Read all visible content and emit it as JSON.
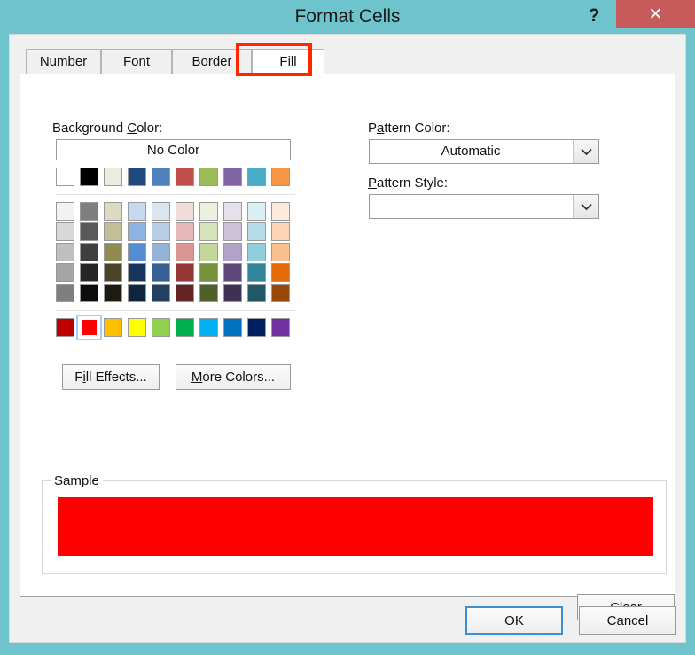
{
  "window": {
    "title": "Format Cells",
    "help_icon": "question-mark-icon",
    "close_icon": "✕",
    "frame_color": "#6ec4cd",
    "close_button_color": "#c75b5b"
  },
  "tabs": [
    {
      "label": "Number",
      "selected": false
    },
    {
      "label": "Font",
      "selected": false
    },
    {
      "label": "Border",
      "selected": false
    },
    {
      "label": "Fill",
      "selected": true
    }
  ],
  "annotation": {
    "target": "Fill",
    "color": "#ff2600",
    "shape": "rectangle"
  },
  "fill_tab": {
    "background_color": {
      "label_prefix": "Background ",
      "label_accel": "C",
      "label_suffix": "olor:",
      "no_color_label": "No Color",
      "theme_colors": [
        "#ffffff",
        "#000000",
        "#eeece1",
        "#1f497d",
        "#4f81bd",
        "#c0504d",
        "#9bbb59",
        "#8064a2",
        "#4bacc6",
        "#f79646"
      ],
      "variant_rows": [
        [
          "#f2f2f2",
          "#7f7f7f",
          "#ddd9c3",
          "#c6d9f0",
          "#dbe5f1",
          "#f2dcdb",
          "#ebf1dd",
          "#e5e0ec",
          "#dbeef3",
          "#fdeada"
        ],
        [
          "#d8d8d8",
          "#595959",
          "#c4bd97",
          "#8db3e2",
          "#b8cce4",
          "#e5b9b7",
          "#d7e3bc",
          "#ccc1d9",
          "#b7dde8",
          "#fbd5b5"
        ],
        [
          "#bfbfbf",
          "#3f3f3f",
          "#938953",
          "#548dd4",
          "#95b3d7",
          "#d99694",
          "#c3d69b",
          "#b2a2c7",
          "#92cddc",
          "#fac08f"
        ],
        [
          "#a5a5a5",
          "#262626",
          "#494429",
          "#17365d",
          "#366092",
          "#953734",
          "#76923c",
          "#5f497a",
          "#31859b",
          "#e36c09"
        ],
        [
          "#7f7f7f",
          "#0c0c0c",
          "#1d1b10",
          "#0f243e",
          "#244061",
          "#632423",
          "#4f6128",
          "#3f3151",
          "#205867",
          "#974806"
        ]
      ],
      "standard_colors": [
        "#c00000",
        "#ff0000",
        "#ffc000",
        "#ffff00",
        "#92d050",
        "#00b050",
        "#00b0f0",
        "#0070c0",
        "#002060",
        "#7030a0"
      ],
      "selected_standard_index": 1,
      "selected_color": "#ff0000"
    },
    "fill_effects_button": {
      "prefix": "F",
      "accel": "i",
      "suffix": "ll Effects..."
    },
    "more_colors_button": {
      "prefix": "",
      "accel": "M",
      "suffix": "ore Colors..."
    },
    "pattern_color": {
      "label_prefix": "P",
      "label_accel": "a",
      "label_suffix": "ttern Color:",
      "value": "Automatic",
      "dropdown_icon": "chevron-down-icon"
    },
    "pattern_style": {
      "label_prefix": "",
      "label_accel": "P",
      "label_suffix": "attern Style:",
      "value": "",
      "dropdown_icon": "chevron-down-icon"
    },
    "sample": {
      "legend": "Sample",
      "swatch_color": "#ff0000"
    },
    "clear_button": {
      "prefix": "Clea",
      "accel": "r",
      "suffix": ""
    }
  },
  "footer": {
    "ok_label": "OK",
    "cancel_label": "Cancel",
    "default_button": "OK"
  }
}
